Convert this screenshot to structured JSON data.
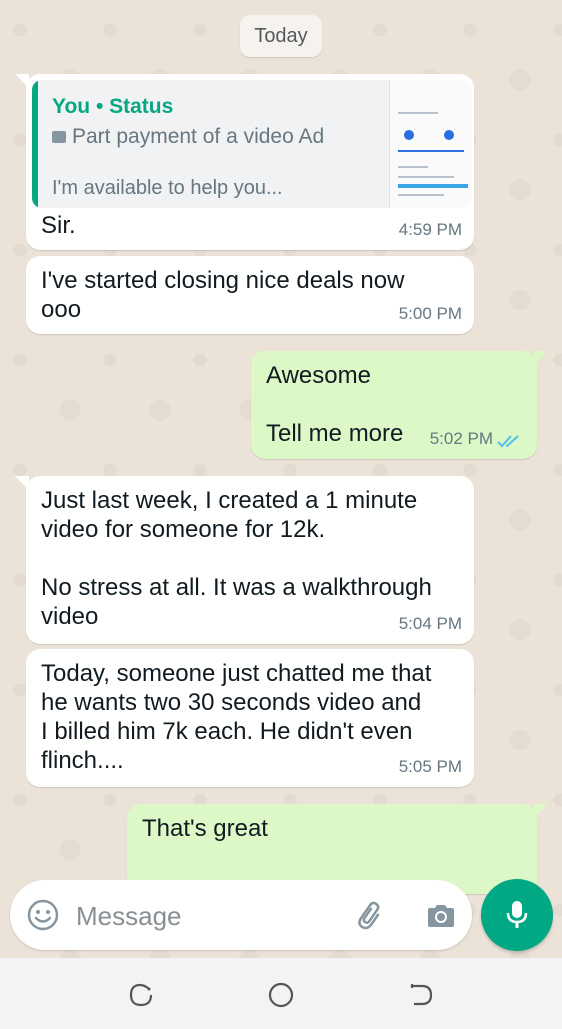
{
  "chat": {
    "date_chip": "Today",
    "messages": [
      {
        "direction": "incoming",
        "reply_to": {
          "author": "You • Status",
          "line": "Part payment of a video Ad",
          "preview": "I'm available to help you..."
        },
        "text": "Sir.",
        "time": "4:59 PM"
      },
      {
        "direction": "incoming",
        "text": "I've started closing nice deals now\nooo",
        "time": "5:00 PM"
      },
      {
        "direction": "outgoing",
        "text": "Awesome\n\nTell me more",
        "time": "5:02 PM",
        "status": "read"
      },
      {
        "direction": "incoming",
        "text": "Just last week, I created a 1 minute\nvideo for someone for 12k.\n\nNo stress at all. It was a walkthrough\nvideo",
        "time": "5:04 PM"
      },
      {
        "direction": "incoming",
        "text": "Today, someone just chatted me that\nhe wants two 30 seconds video and\nI billed him 7k each. He didn't even\nflinch....",
        "time": "5:05 PM"
      },
      {
        "direction": "outgoing",
        "text": "That's great",
        "time": ""
      }
    ]
  },
  "composer": {
    "placeholder": "Message",
    "icons": [
      "emoji-icon",
      "attach-icon",
      "camera-icon",
      "mic-icon"
    ]
  },
  "navbar": {
    "icons": [
      "recent-apps-icon",
      "home-icon",
      "back-icon"
    ]
  },
  "colors": {
    "accent": "#00a884",
    "outgoing_bubble": "#dcf8c6",
    "incoming_bubble": "#ffffff",
    "read_ticks": "#53bdeb"
  }
}
